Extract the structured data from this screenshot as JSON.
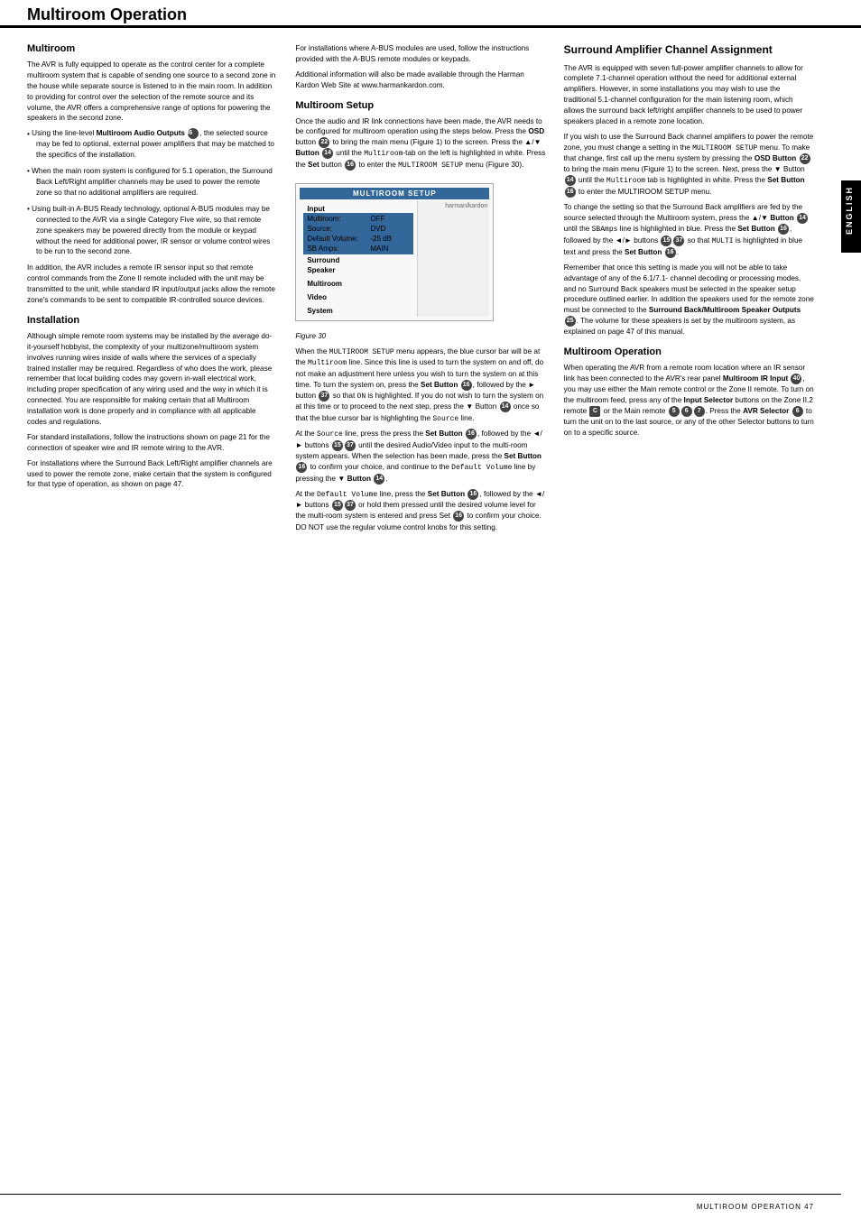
{
  "page": {
    "title": "Multiroom Operation",
    "footer_text": "MULTIROOM OPERATION   47",
    "english_label": "ENGLISH"
  },
  "left_col": {
    "section1": {
      "heading": "Multiroom",
      "paragraphs": [
        "The AVR is fully equipped to operate as the control center for a complete multiroom system that is capable of sending one source to a second zone in the house while separate source is listened to in the main room. In addition to providing for control over the selection of the remote source and its volume, the AVR offers a comprehensive range of options for powering the speakers in the second zone.",
        "• Using the line-level Multiroom Audio Outputs [36], the selected source may be fed to optional, external power amplifiers that may be matched to the specifics of the installation.",
        "• When the main room system is configured for 5.1 operation, the Surround Back Left/Right amplifier channels may be used to power the remote zone so that no additional amplifiers are required.",
        "• Using built-in A-BUS Ready technology, optional A-BUS modules may be connected to the AVR via a single Category Five wire, so that remote zone speakers may be powered directly from the module or keypad without the need for additional power, IR sensor or volume control wires to be run to the second zone.",
        "In addition, the AVR includes a remote IR sensor input so that remote control commands from the Zone II remote included with the unit may be transmitted to the unit, while standard IR input/output jacks allow the remote zone's commands to be sent to compatible IR-controlled source devices."
      ]
    },
    "section2": {
      "heading": "Installation",
      "paragraphs": [
        "Although simple remote room systems may be installed by the average do-it-yourself hobbyist, the complexity of your multizone/multiroom system involves running wires inside of walls where the services of a specially trained installer may be required. Regardless of who does the work, please remember that local building codes may govern in-wall electrical work, including proper specification of any wiring used and the way in which it is connected. You are responsible for making certain that all Multiroom installation work is done properly and in compliance with all applicable codes and regulations.",
        "For standard installations, follow the instructions shown on page 21 for the connection of speaker wire and IR remote wiring to the AVR.",
        "For installations where the Surround Back Left/Right amplifier channels are used to power the remote zone, make certain that the system is configured for that type of operation, as shown on page 47."
      ]
    }
  },
  "mid_col": {
    "section1": {
      "paragraphs": [
        "For installations where A-BUS modules are used, follow the instructions provided with the A-BUS remote modules or keypads.",
        "Additional information will also be made available through the Harman Kardon Web Site at www.harmankardon.com."
      ]
    },
    "section2": {
      "heading": "Multiroom Setup",
      "paragraphs": [
        "Once the audio and IR link connections have been made, the AVR needs to be configured for multiroom operation using the steps below. Press the OSD button [22] to bring the main menu (Figure 1) to the screen. Press the ▲/▼ Button [14] until the Multiroom-tab on the left is highlighted in white. Press the Set button [16] to enter the MULTIROOM SETUP menu (Figure 30).",
        "When the MULTIROOM SETUP menu appears, the blue cursor bar will be at the Multiroom line. Since this line is used to turn the system on and off, do not make an adjustment here unless you wish to turn the system on at this time. To turn the system on, press the Set Button [16], followed by the ► button [37] so that ON is highlighted. If you do not wish to turn the system on at this time or to proceed to the next step, press the ▼ Button [14] once so that the blue cursor bar is highlighting the Source line.",
        "At the Source line, press the press the Set Button [16], followed by the ◄/► buttons [15][37] until the desired Audio/Video input to the multi-room system appears. When the selection has been made, press the Set Button [16] to confirm your choice, and continue to the Default Volume line by pressing the ▼ Button [14].",
        "At the Default Volume line, press the Set Button [16], followed by the ◄/► buttons [15][37] or hold them pressed until the desired volume level for the multi-room system is entered and press Set [16] to confirm your choice. DO NOT use the regular volume control knobs for this setting."
      ]
    },
    "figure": {
      "title": "MULTIROOM SETUP",
      "rows": [
        {
          "label": "Input",
          "section": true
        },
        {
          "label": "Multiroom:",
          "value": "OFF"
        },
        {
          "label": "Source:",
          "value": "DVD"
        },
        {
          "label": "Default Volume:",
          "value": "-25 dB"
        },
        {
          "label": "SB Amps:",
          "value": "MAIN"
        },
        {
          "label": "Surround",
          "section": true
        },
        {
          "label": "Speaker",
          "section": true
        },
        {
          "label": "",
          "section": true
        },
        {
          "label": "Multiroom",
          "section": true
        },
        {
          "label": "",
          "section": true
        },
        {
          "label": "Video",
          "section": true
        },
        {
          "label": "",
          "section": true
        },
        {
          "label": "System",
          "section": true
        }
      ],
      "caption": "Figure 30"
    }
  },
  "right_col": {
    "section1": {
      "heading": "Surround Amplifier Channel Assignment",
      "paragraphs": [
        "The AVR is equipped with seven full-power amplifier channels to allow for complete 7.1-channel operation without the need for additional external amplifiers. However, in some installations you may wish to use the traditional 5.1-channel configuration for the main listening room, which allows the surround back left/right amplifier channels to be used to power speakers placed in a remote zone location.",
        "If you wish to use the Surround Back channel amplifiers to power the remote zone, you must change a setting in the MULTIROOM SETUP menu. To make that change, first call up the menu system by pressing the OSD Button [22] to bring the main menu (Figure 1) to the screen. Next, press the ▼ Button [14] until the Multiroom tab is highlighted in white. Press the Set Button [16] to enter the MULTIROOM SETUP menu.",
        "To change the setting so that the Surround Back amplifiers are fed by the source selected through the Multiroom system, press the ▲/▼ Button [14] until the SBAmps line is highlighted in blue. Press the Set Button [16], followed by the ◄/► buttons [15][37] so that MULTI is highlighted in blue text and press the Set Button [16].",
        "Remember that once this setting is made you will not be able to take advantage of any of the 6.1/7.1- channel decoding or processing modes, and no Surround Back speakers must be selected in the speaker setup procedure outlined earlier. In addition the speakers used for the remote zone must be connected to the Surround Back/Multiroom Speaker Outputs [25]. The volume for these speakers is set by the multiroom system, as explained on page 47 of this manual."
      ]
    },
    "section2": {
      "heading": "Multiroom Operation",
      "paragraphs": [
        "When operating the AVR from a remote room location where an IR sensor link has been connected to the AVR's rear panel Multiroom IR Input [40], you may use either the Main remote control or the Zone II remote. To turn on the multiroom feed, press any of the Input Selector buttons on the Zone II.2 remote [C] or the Main remote [5][6][7]. Press the AVR Selector [6] to turn the unit on to the last source, or any of the other Selector buttons to turn on to a specific source."
      ]
    }
  }
}
